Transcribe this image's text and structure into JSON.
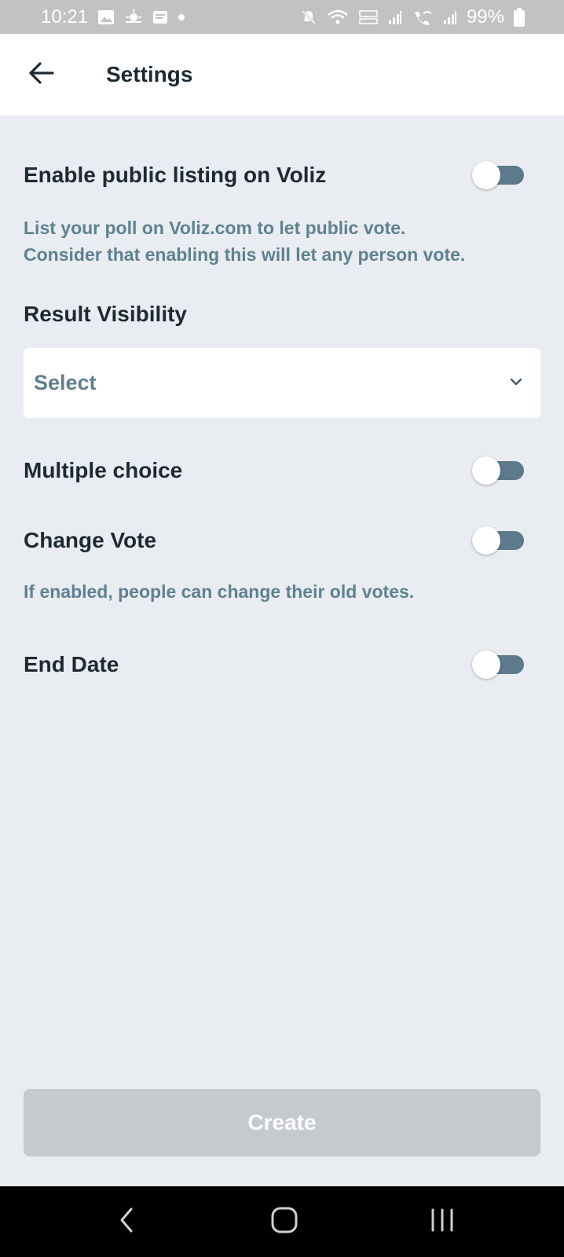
{
  "status_bar": {
    "time": "10:21",
    "battery": "99%",
    "icons": [
      "gallery-icon",
      "weather-icon",
      "message-icon",
      "dot-icon",
      "mute-icon",
      "wifi-icon",
      "volte-icon",
      "signal-icon",
      "wifi-call-icon",
      "battery-icon"
    ]
  },
  "header": {
    "back_icon": "arrow-left-icon",
    "title": "Settings"
  },
  "settings": {
    "public_listing": {
      "label": "Enable public listing on Voliz",
      "enabled": false,
      "description_line1": "List your poll on Voliz.com to let public vote.",
      "description_line2": "Consider that enabling this will let any person vote."
    },
    "result_visibility": {
      "label": "Result Visibility",
      "selected": "Select",
      "icon": "chevron-down-icon"
    },
    "multiple_choice": {
      "label": "Multiple choice",
      "enabled": false
    },
    "change_vote": {
      "label": "Change Vote",
      "enabled": false,
      "description": "If enabled, people can change their old votes."
    },
    "end_date": {
      "label": "End Date",
      "enabled": false
    }
  },
  "footer": {
    "create_label": "Create",
    "create_disabled": true
  },
  "colors": {
    "background": "#e9ecf0",
    "toggle_track": "#5c7a89",
    "description_text": "#5f8190",
    "button_disabled": "#c6cacf"
  }
}
